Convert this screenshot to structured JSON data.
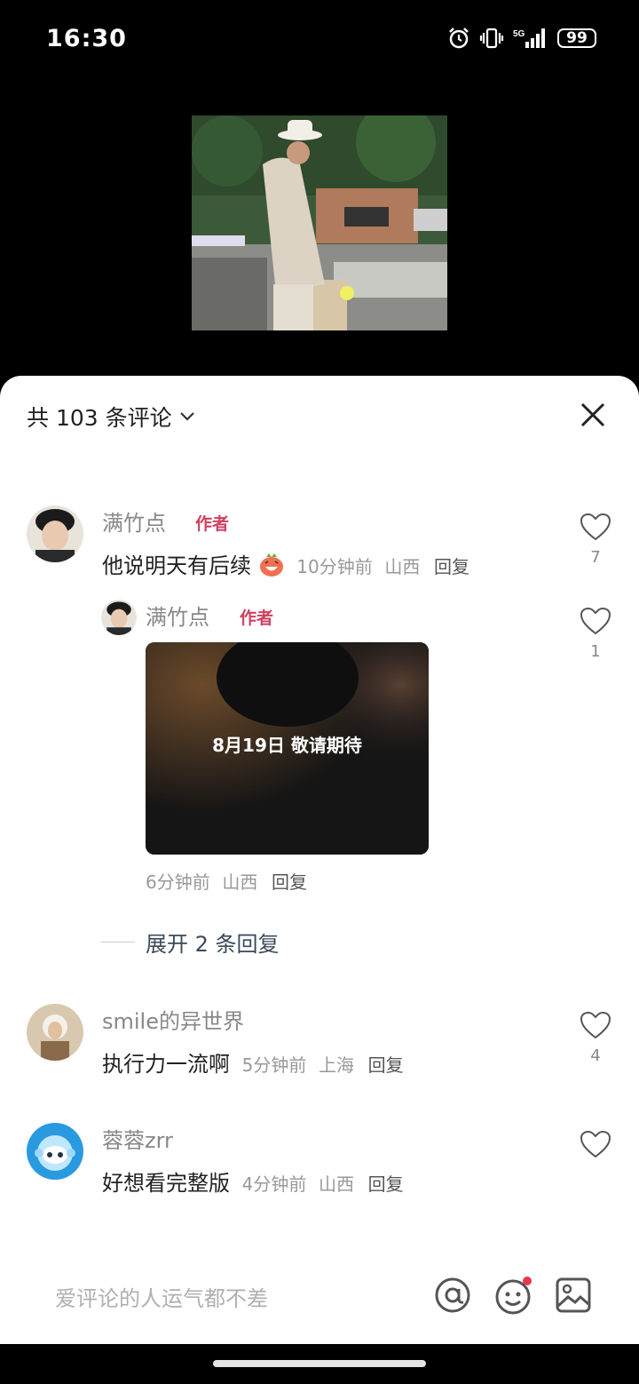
{
  "status": {
    "time": "16:30",
    "battery": "99"
  },
  "header": {
    "count_label": "共 103 条评论"
  },
  "comments": [
    {
      "user": "满竹点",
      "badge": "作者",
      "text": "他说明天有后续",
      "time": "10分钟前",
      "location": "山西",
      "reply_label": "回复",
      "likes": "7",
      "replies": [
        {
          "user": "满竹点",
          "badge": "作者",
          "image_text": "8月19日 敬请期待",
          "time": "6分钟前",
          "location": "山西",
          "reply_label": "回复",
          "likes": "1"
        }
      ],
      "expand_label": "展开 2 条回复"
    },
    {
      "user": "smile的异世界",
      "text": "执行力一流啊",
      "time": "5分钟前",
      "location": "上海",
      "reply_label": "回复",
      "likes": "4"
    },
    {
      "user": "蓉蓉zrr",
      "text": "好想看完整版",
      "time": "4分钟前",
      "location": "山西",
      "reply_label": "回复",
      "likes": ""
    }
  ],
  "input": {
    "placeholder": "爱评论的人运气都不差"
  },
  "icons": [
    "alarm-icon",
    "vibrate-icon",
    "signal-icon",
    "battery-icon",
    "chevron-down-icon",
    "close-icon",
    "heart-icon",
    "emoji-icon",
    "at-icon",
    "image-icon"
  ]
}
